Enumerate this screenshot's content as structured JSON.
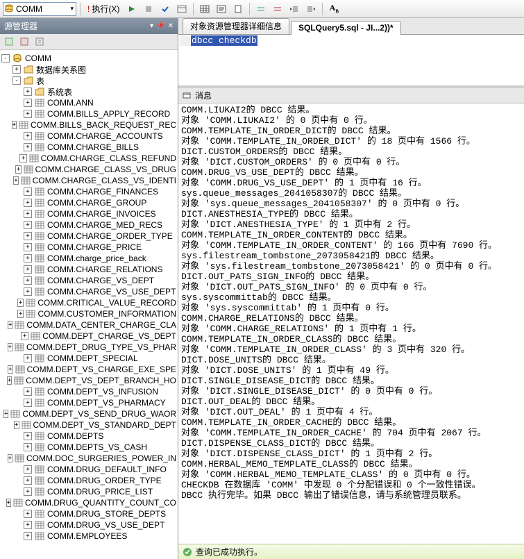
{
  "toolbar": {
    "db_selected": "COMM",
    "exec_label": "执行(X)"
  },
  "left_panel": {
    "title": "源管理器"
  },
  "tree": {
    "root": "COMM",
    "diagrams": "数据库关系图",
    "tables": "表",
    "sys_tables": "系统表",
    "items": [
      "COMM.ANN",
      "COMM.BILLS_APPLY_RECORD",
      "COMM.BILLS_BACK_REQUEST_REC",
      "COMM.CHARGE_ACCOUNTS",
      "COMM.CHARGE_BILLS",
      "COMM.CHARGE_CLASS_REFUND",
      "COMM.CHARGE_CLASS_VS_DRUG",
      "COMM.CHARGE_CLASS_VS_IDENTI",
      "COMM.CHARGE_FINANCES",
      "COMM.CHARGE_GROUP",
      "COMM.CHARGE_INVOICES",
      "COMM.CHARGE_MED_RECS",
      "COMM.CHARGE_ORDER_TYPE",
      "COMM.CHARGE_PRICE",
      "COMM.charge_price_back",
      "COMM.CHARGE_RELATIONS",
      "COMM.CHARGE_VS_DEPT",
      "COMM.CHARGE_VS_USE_DEPT",
      "COMM.CRITICAL_VALUE_RECORD",
      "COMM.CUSTOMER_INFORMATION",
      "COMM.DATA_CENTER_CHARGE_CLA",
      "COMM.DEPT_CHARGE_VS_DEPT",
      "COMM.DEPT_DRUG_TYPE_VS_PHAR",
      "COMM.DEPT_SPECIAL",
      "COMM.DEPT_VS_CHARGE_EXE_SPE",
      "COMM.DEPT_VS_DEPT_BRANCH_HO",
      "COMM.DEPT_VS_INFUSION",
      "COMM.DEPT_VS_PHARMACY",
      "COMM.DEPT_VS_SEND_DRUG_WAOR",
      "COMM.DEPT_VS_STANDARD_DEPT",
      "COMM.DEPTS",
      "COMM.DEPTS_VS_CASH",
      "COMM.DOC_SURGERIES_POWER_IN",
      "COMM.DRUG_DEFAULT_INFO",
      "COMM.DRUG_ORDER_TYPE",
      "COMM.DRUG_PRICE_LIST",
      "COMM.DRUG_QUANTITY_COUNT_CO",
      "COMM.DRUG_STORE_DEPTS",
      "COMM.DRUG_VS_USE_DEPT",
      "COMM.EMPLOYEES"
    ]
  },
  "tabs": {
    "t1": "对象资源管理器详细信息",
    "t2": "SQLQuery5.sql - JI...2))*"
  },
  "editor": {
    "line1": "dbcc checkdb"
  },
  "messages_tab": "消息",
  "output_lines": [
    "COMM.LIUKAI2的 DBCC 结果。",
    "对象 'COMM.LIUKAI2' 的 0 页中有 0 行。",
    "COMM.TEMPLATE_IN_ORDER_DICT的 DBCC 结果。",
    "对象 'COMM.TEMPLATE_IN_ORDER_DICT' 的 18 页中有 1566 行。",
    "DICT.CUSTOM_ORDERS的 DBCC 结果。",
    "对象 'DICT.CUSTOM_ORDERS' 的 0 页中有 0 行。",
    "COMM.DRUG_VS_USE_DEPT的 DBCC 结果。",
    "对象 'COMM.DRUG_VS_USE_DEPT' 的 1 页中有 16 行。",
    "sys.queue_messages_2041058307的 DBCC 结果。",
    "对象 'sys.queue_messages_2041058307' 的 0 页中有 0 行。",
    "DICT.ANESTHESIA_TYPE的 DBCC 结果。",
    "对象 'DICT.ANESTHESIA_TYPE' 的 1 页中有 2 行。",
    "COMM.TEMPLATE_IN_ORDER_CONTENT的 DBCC 结果。",
    "对象 'COMM.TEMPLATE_IN_ORDER_CONTENT' 的 166 页中有 7690 行。",
    "sys.filestream_tombstone_2073058421的 DBCC 结果。",
    "对象 'sys.filestream_tombstone_2073058421' 的 0 页中有 0 行。",
    "DICT.OUT_PATS_SIGN_INFO的 DBCC 结果。",
    "对象 'DICT.OUT_PATS_SIGN_INFO' 的 0 页中有 0 行。",
    "sys.syscommittab的 DBCC 结果。",
    "对象 'sys.syscommittab' 的 1 页中有 0 行。",
    "COMM.CHARGE_RELATIONS的 DBCC 结果。",
    "对象 'COMM.CHARGE_RELATIONS' 的 1 页中有 1 行。",
    "COMM.TEMPLATE_IN_ORDER_CLASS的 DBCC 结果。",
    "对象 'COMM.TEMPLATE_IN_ORDER_CLASS' 的 3 页中有 320 行。",
    "DICT.DOSE_UNITS的 DBCC 结果。",
    "对象 'DICT.DOSE_UNITS' 的 1 页中有 49 行。",
    "DICT.SINGLE_DISEASE_DICT的 DBCC 结果。",
    "对象 'DICT.SINGLE_DISEASE_DICT' 的 0 页中有 0 行。",
    "DICT.OUT_DEAL的 DBCC 结果。",
    "对象 'DICT.OUT_DEAL' 的 1 页中有 4 行。",
    "COMM.TEMPLATE_IN_ORDER_CACHE的 DBCC 结果。",
    "对象 'COMM.TEMPLATE_IN_ORDER_CACHE' 的 704 页中有 2067 行。",
    "DICT.DISPENSE_CLASS_DICT的 DBCC 结果。",
    "对象 'DICT.DISPENSE_CLASS_DICT' 的 1 页中有 2 行。",
    "COMM.HERBAL_MEMO_TEMPLATE_CLASS的 DBCC 结果。",
    "对象 'COMM.HERBAL_MEMO_TEMPLATE_CLASS' 的 0 页中有 0 行。",
    "CHECKDB 在数据库 'COMM' 中发现 0 个分配错误和 0 个一致性错误。",
    "DBCC 执行完毕。如果 DBCC 输出了错误信息，请与系统管理员联系。"
  ],
  "status": "查询已成功执行。"
}
